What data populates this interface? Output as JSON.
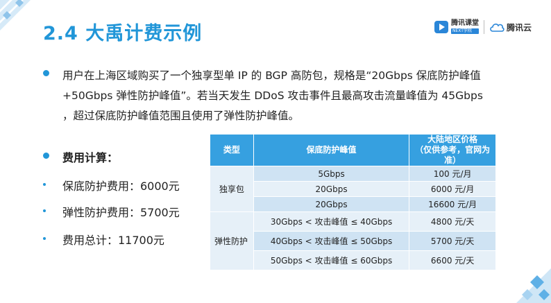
{
  "slide": {
    "title": "2.4 大禹计费示例"
  },
  "logos": {
    "ketang_cn": "腾讯课堂",
    "ketang_en": "NEXT学院",
    "cloud_text": "腾讯云",
    "ketang_icon": "play-icon",
    "cloud_icon": "cloud-icon"
  },
  "intro": {
    "line1": "用户在上海区域购买了一个独享型单 IP 的 BGP 高防包，规格是“20Gbps 保底防护峰值",
    "line2": "+50Gbps 弹性防护峰值”。若当天发生 DDoS 攻击事件且最高攻击流量峰值为 45Gbps",
    "line3": "，超过保底防护峰值范围且使用了弹性防护峰值。"
  },
  "cost": {
    "heading": "费用计算：",
    "items": [
      "保底防护费用：6000元",
      "弹性防护费用：5700元",
      "费用总计：11700元"
    ]
  },
  "table": {
    "headers": {
      "type": "类型",
      "peak": "保底防护峰值",
      "price_line1": "大陆地区价格",
      "price_line2": "（仅供参考，官网为准）"
    },
    "groups": [
      {
        "type": "独享包",
        "rows": [
          {
            "peak": "5Gbps",
            "price": "100 元/月"
          },
          {
            "peak": "20Gbps",
            "price": "6000 元/月"
          },
          {
            "peak": "20Gbps",
            "price": "16600 元/月"
          }
        ]
      },
      {
        "type": "弹性防护",
        "rows": [
          {
            "peak": "30Gbps < 攻击峰值 ≤ 40Gbps",
            "price": "4800 元/天"
          },
          {
            "peak": "40Gbps < 攻击峰值 ≤ 50Gbps",
            "price": "5700 元/天"
          },
          {
            "peak": "50Gbps < 攻击峰值 ≤ 60Gbps",
            "price": "6600 元/天"
          }
        ]
      }
    ]
  },
  "colors": {
    "accent": "#2196d8",
    "header_bg": "#36a0e0",
    "row_dark": "#cfe3f3",
    "row_light": "#e6f0f8"
  }
}
